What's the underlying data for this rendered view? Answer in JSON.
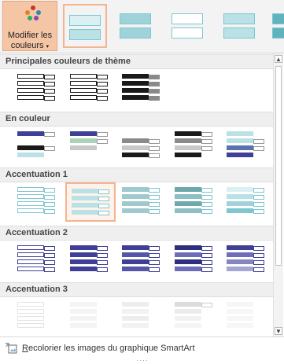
{
  "ribbon": {
    "modify_button": {
      "line1": "Modifier les",
      "line2": "couleurs",
      "caret": "▾"
    },
    "palette_colors": [
      "#c0392b",
      "#e67e22",
      "#2e86c1",
      "#27ae60",
      "#8e44ad"
    ],
    "thumbnail_styles": [
      "colorful-accent-1-outline",
      "colorful-accent-1-fill",
      "colorful-accent-1-soft",
      "colorful-accent-1-white",
      "colorful-accent-1-gradient",
      "colorful-accent-1-dark"
    ]
  },
  "sections": [
    {
      "title": "Principales couleurs de thème",
      "items": [
        "theme-dark-1-outline",
        "theme-dark-2-outline",
        "theme-dark-fill"
      ]
    },
    {
      "title": "En couleur",
      "items": [
        "colorful-1",
        "colorful-2",
        "colorful-3",
        "colorful-4",
        "colorful-5"
      ]
    },
    {
      "title": "Accentuation 1",
      "items": [
        "accent1-1",
        "accent1-2",
        "accent1-3",
        "accent1-4",
        "accent1-5"
      ]
    },
    {
      "title": "Accentuation 2",
      "items": [
        "accent2-1",
        "accent2-2",
        "accent2-3",
        "accent2-4",
        "accent2-5"
      ]
    },
    {
      "title": "Accentuation 3",
      "items": [
        "accent3-1",
        "accent3-2",
        "accent3-3",
        "accent3-4",
        "accent3-5"
      ]
    }
  ],
  "selected": {
    "section": 2,
    "item": 1
  },
  "colors": {
    "selection_border": "#f3b48f",
    "accent1": "#7fc6cf",
    "accent1_light": "#b9e1e6",
    "accent2": "#3f3f97",
    "accent2_light": "#8585c4",
    "dark": "#1a1a1a",
    "gray": "#8a8a8a",
    "orange_highlight": "#f5c6a5"
  },
  "footer": {
    "recolor_mnemonic": "R",
    "recolor_label": "ecolorier les images du graphique SmartArt",
    "grip": "····"
  },
  "icons": {
    "palette": "palette-icon",
    "recolor": "recolor-image-icon",
    "scroll_up": "scroll-up-arrow-icon",
    "scroll_down": "scroll-down-arrow-icon"
  }
}
